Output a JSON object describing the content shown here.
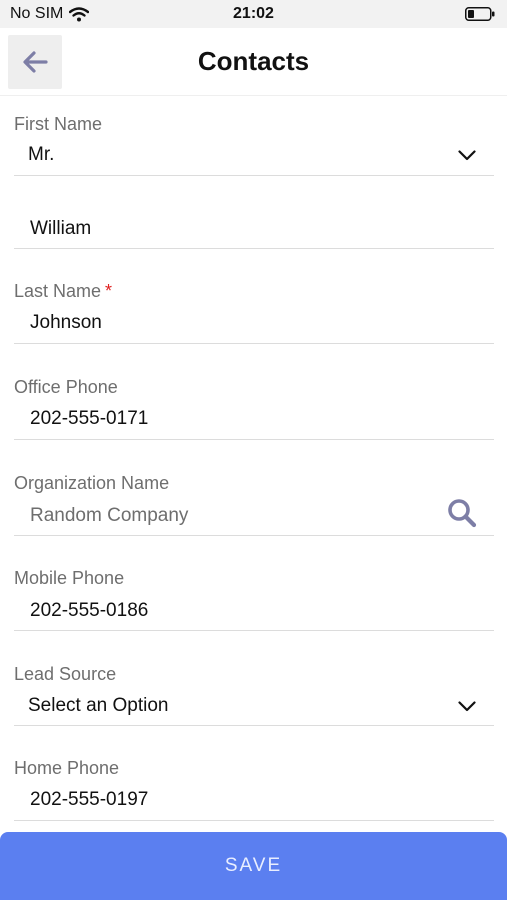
{
  "status_bar": {
    "carrier": "No SIM",
    "time": "21:02",
    "wifi_icon": "wifi-icon",
    "battery_icon": "battery-icon"
  },
  "nav": {
    "title": "Contacts",
    "back_icon": "arrow-left-icon"
  },
  "fields": {
    "salutation": {
      "label": "First Name",
      "value": "Mr."
    },
    "first_name": {
      "value": "William"
    },
    "last_name": {
      "label": "Last Name",
      "required_mark": "*",
      "value": "Johnson"
    },
    "office_phone": {
      "label": "Office Phone",
      "value": "202-555-0171"
    },
    "organization": {
      "label": "Organization Name",
      "placeholder": "Random Company"
    },
    "mobile_phone": {
      "label": "Mobile Phone",
      "value": "202-555-0186"
    },
    "lead_source": {
      "label": "Lead Source",
      "value": "Select an Option"
    },
    "home_phone": {
      "label": "Home Phone",
      "value": "202-555-0197"
    }
  },
  "actions": {
    "save_label": "SAVE"
  },
  "colors": {
    "accent": "#5b7ff0",
    "icon": "#7d7ea6",
    "required": "#e02020"
  }
}
